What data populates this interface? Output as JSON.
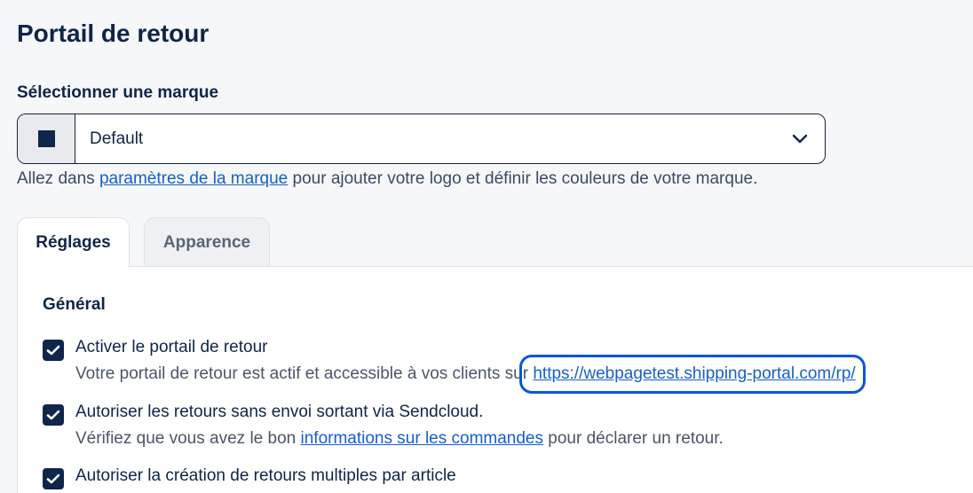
{
  "page": {
    "title": "Portail de retour"
  },
  "brand": {
    "label": "Sélectionner une marque",
    "selected": "Default",
    "swatch_color": "#10254a",
    "help_before": "Allez dans ",
    "help_link": "paramètres de la marque",
    "help_after": " pour ajouter votre logo et définir les couleurs de votre marque."
  },
  "tabs": [
    {
      "label": "Réglages",
      "active": true
    },
    {
      "label": "Apparence",
      "active": false
    }
  ],
  "general": {
    "title": "Général",
    "options": [
      {
        "label": "Activer le portail de retour",
        "checked": true,
        "desc_before": "Votre portail de retour est actif et accessible à vos clients sur ",
        "desc_link": "https://webpagetest.shipping-portal.com/rp/",
        "desc_after": ""
      },
      {
        "label": "Autoriser les retours sans envoi sortant via Sendcloud.",
        "checked": true,
        "desc_before": "Vérifiez que vous avez le bon ",
        "desc_link": "informations sur les commandes",
        "desc_after": " pour déclarer un retour."
      },
      {
        "label": "Autoriser la création de retours multiples par article",
        "checked": true
      }
    ]
  },
  "colors": {
    "primary": "#10254a",
    "link": "#1560c8",
    "highlight": "#0a54e0"
  }
}
